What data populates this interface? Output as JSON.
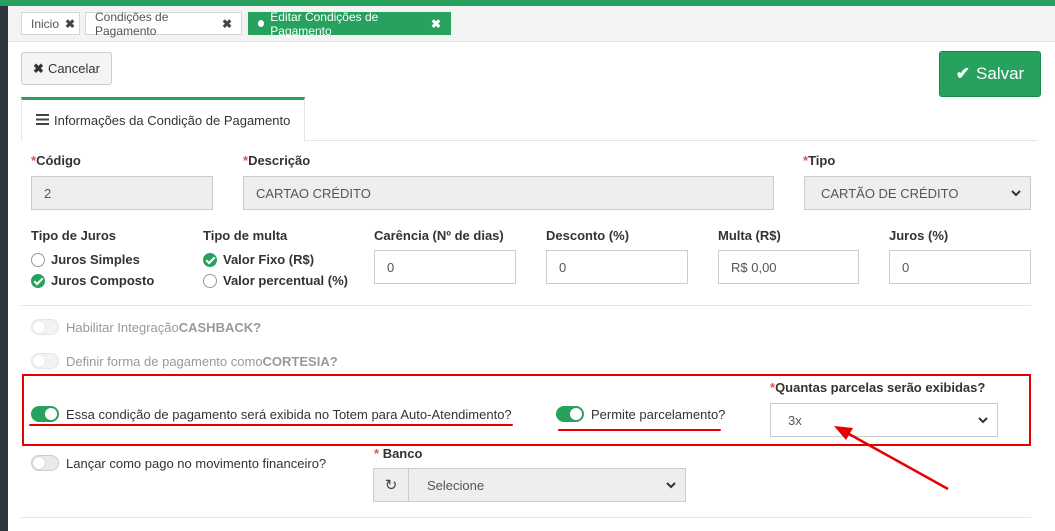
{
  "tabs": [
    {
      "label": "Inicio",
      "close": "✖"
    },
    {
      "label": "Condições de Pagamento",
      "close": "✖"
    },
    {
      "label": "Editar Condições de Pagamento",
      "close": "✖"
    }
  ],
  "actions": {
    "cancel_label": "Cancelar",
    "cancel_icon": "✖",
    "save_label": "Salvar",
    "save_icon": "✔"
  },
  "section": {
    "title": "Informações da Condição de Pagamento",
    "icon": "list-icon"
  },
  "form": {
    "required_mark": "*",
    "codigo": {
      "label": "Código",
      "value": "2"
    },
    "descricao": {
      "label": "Descrição",
      "value": "CARTAO CRÉDITO"
    },
    "tipo": {
      "label": "Tipo",
      "value": "CARTÃO DE CRÉDITO"
    },
    "tipo_juros": {
      "label": "Tipo de Juros",
      "options": [
        "Juros Simples",
        "Juros Composto"
      ],
      "selected": "Juros Composto"
    },
    "tipo_multa": {
      "label": "Tipo de multa",
      "options": [
        "Valor Fixo (R$)",
        "Valor percentual (%)"
      ],
      "selected": "Valor Fixo (R$)"
    },
    "carencia": {
      "label": "Carência (Nº de dias)",
      "value": "0"
    },
    "desconto": {
      "label": "Desconto (%)",
      "value": "0"
    },
    "multa": {
      "label": "Multa (R$)",
      "value": "R$ 0,00"
    },
    "juros": {
      "label": "Juros (%)",
      "value": "0"
    }
  },
  "toggles": {
    "cashback": {
      "text": "Habilitar Integração ",
      "bold": "CASHBACK?",
      "on": false,
      "disabled": true
    },
    "cortesia": {
      "text": "Definir forma de pagamento como ",
      "bold": "CORTESIA?",
      "on": false,
      "disabled": true
    },
    "totem": {
      "text": "Essa condição de pagamento será exibida no Totem para Auto-Atendimento?",
      "on": true
    },
    "parcelamento": {
      "text": "Permite parcelamento?",
      "on": true
    },
    "lancar": {
      "text": "Lançar como pago no movimento financeiro?",
      "on": false
    }
  },
  "parcelas": {
    "label": "Quantas parcelas serão exibidas?",
    "value": "3x"
  },
  "banco": {
    "label": "Banco",
    "value": "Selecione",
    "refresh_icon": "↻"
  },
  "annotation_color": "#e60000",
  "accent": "#26a15e"
}
